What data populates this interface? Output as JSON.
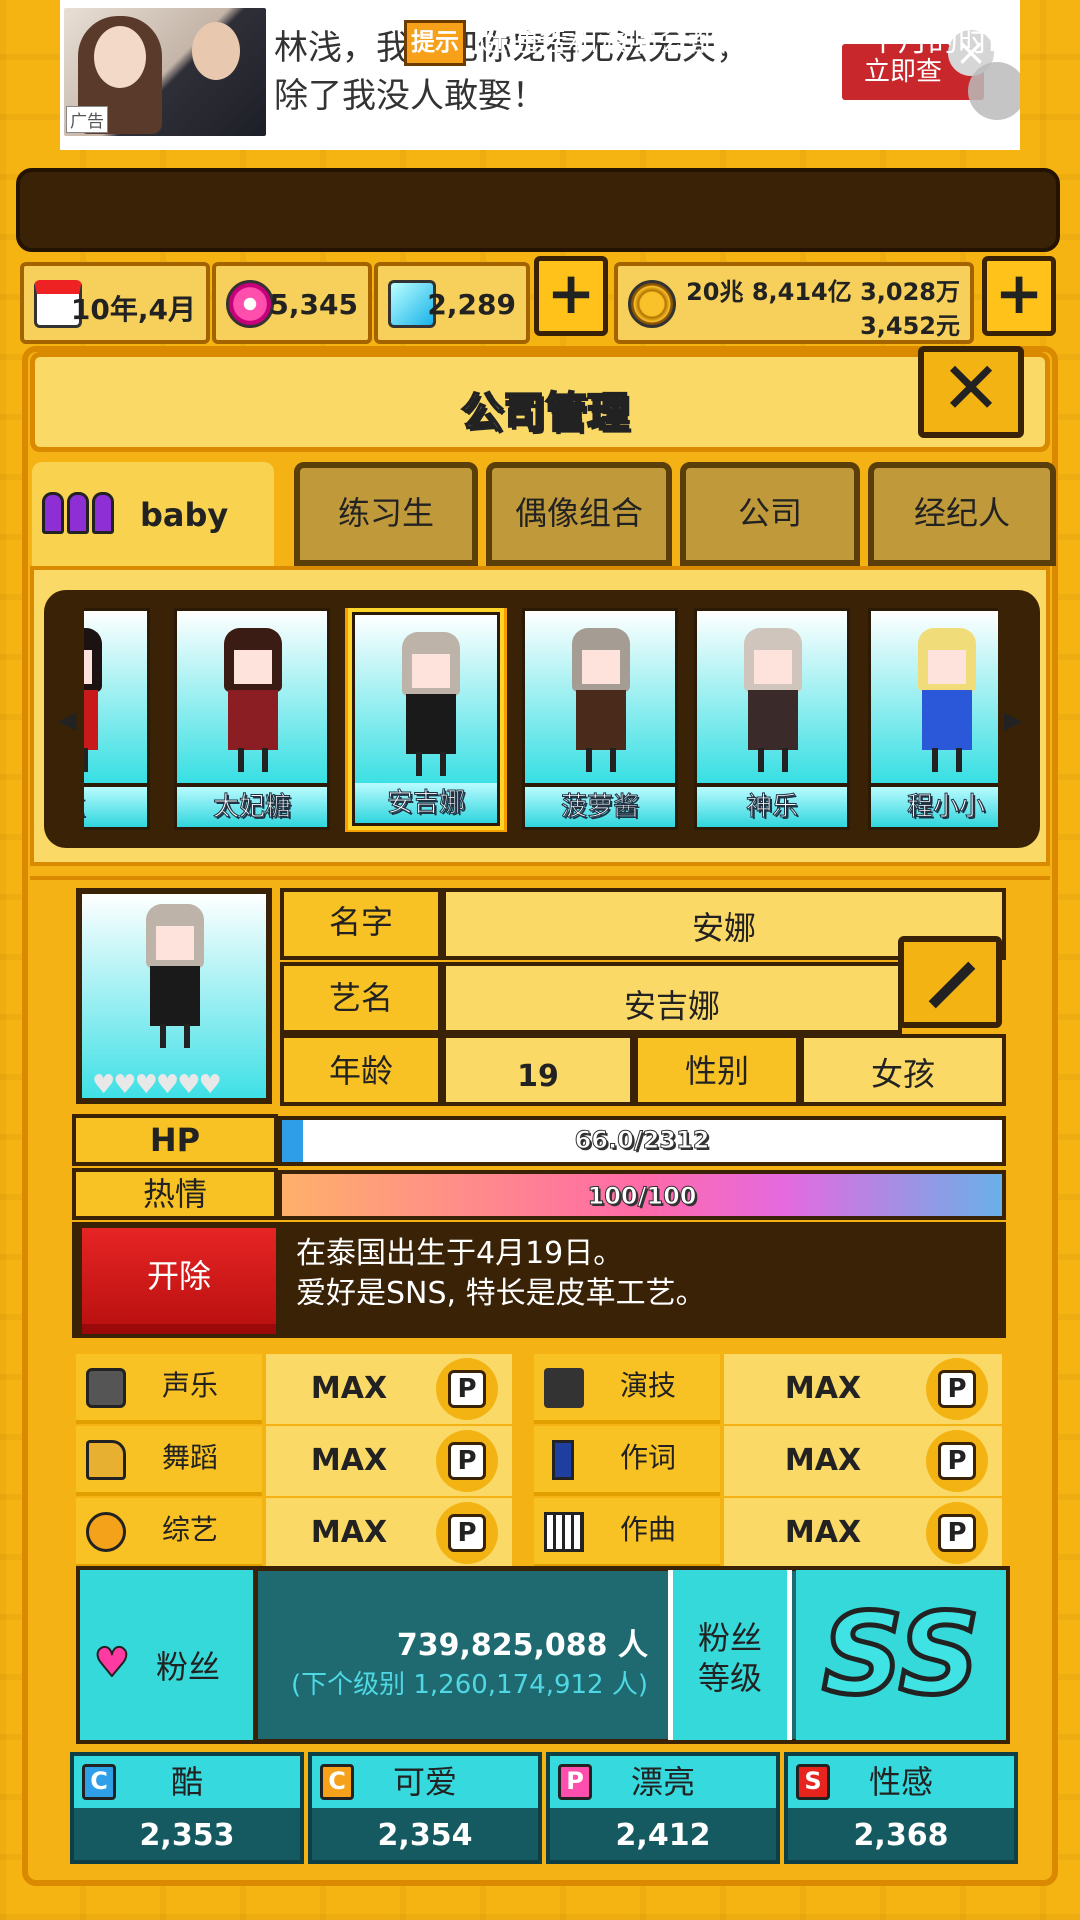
{
  "ad": {
    "text": "林浅，我要把你宠得无法无天，\n除了我没人敢娶！",
    "tag": "广告",
    "button": "立即查",
    "close": "×"
  },
  "tips": {
    "icon_label": "提示",
    "text": "赶通告和演唱会都需要耗费一个月的时i"
  },
  "resources": {
    "date": "10年,4月",
    "gems_pink": "5,345",
    "gems_blue": "2,289",
    "money_line1": "20兆 8,414亿 3,028万",
    "money_line2": "3,452元",
    "add": "+"
  },
  "panel": {
    "title": "公司管理",
    "close": "✕"
  },
  "tabs": [
    {
      "label": "baby"
    },
    {
      "label": "练习生"
    },
    {
      "label": "偶像组合"
    },
    {
      "label": "公司"
    },
    {
      "label": "经纪人"
    }
  ],
  "roster": [
    {
      "name": "拉",
      "hair": "#1c1212",
      "outfit": "#c81a1a"
    },
    {
      "name": "太妃糖",
      "hair": "#3b1c14",
      "outfit": "#8b1e22"
    },
    {
      "name": "安吉娜",
      "hair": "#bdb3a8",
      "outfit": "#1a1a1a",
      "selected": true
    },
    {
      "name": "菠萝酱",
      "hair": "#a59c94",
      "outfit": "#4a2a1a"
    },
    {
      "name": "神乐",
      "hair": "#cfc5bd",
      "outfit": "#3a2a2a"
    },
    {
      "name": "程小小",
      "hair": "#f1dc7a",
      "outfit": "#2a58d8"
    }
  ],
  "profile": {
    "name_label": "名字",
    "name": "安娜",
    "stage_label": "艺名",
    "stage_name": "安吉娜",
    "age_label": "年龄",
    "age": "19",
    "sex_label": "性别",
    "sex": "女孩",
    "hearts": "♥♥♥♥♥♥"
  },
  "hp": {
    "label": "HP",
    "text": "66.0/2312",
    "current": 66.0,
    "max": 2312
  },
  "passion": {
    "label": "热情",
    "text": "100/100",
    "current": 100,
    "max": 100
  },
  "fire_button": "开除",
  "bio": "在泰国出生于4月19日。\n爱好是SNS, 特长是皮革工艺。",
  "skills": [
    {
      "label": "声乐",
      "value": "MAX",
      "p": "P",
      "icon": "microphone-icon"
    },
    {
      "label": "演技",
      "value": "MAX",
      "p": "P",
      "icon": "camera-icon"
    },
    {
      "label": "舞蹈",
      "value": "MAX",
      "p": "P",
      "icon": "shoe-icon"
    },
    {
      "label": "作词",
      "value": "MAX",
      "p": "P",
      "icon": "pen-icon"
    },
    {
      "label": "综艺",
      "value": "MAX",
      "p": "P",
      "icon": "mask-icon"
    },
    {
      "label": "作曲",
      "value": "MAX",
      "p": "P",
      "icon": "keyboard-icon"
    }
  ],
  "fans": {
    "label": "粉丝",
    "count": "739,825,088 人",
    "next": "(下个级别 1,260,174,912 人)",
    "level_label": "粉丝\n等级",
    "level": "SS"
  },
  "attributes": [
    {
      "icon": "C",
      "label": "酷",
      "value": "2,353"
    },
    {
      "icon": "C",
      "label": "可爱",
      "value": "2,354"
    },
    {
      "icon": "P",
      "label": "漂亮",
      "value": "2,412"
    },
    {
      "icon": "S",
      "label": "性感",
      "value": "2,368"
    }
  ],
  "arrows": {
    "left": "◀",
    "right": "▶"
  }
}
